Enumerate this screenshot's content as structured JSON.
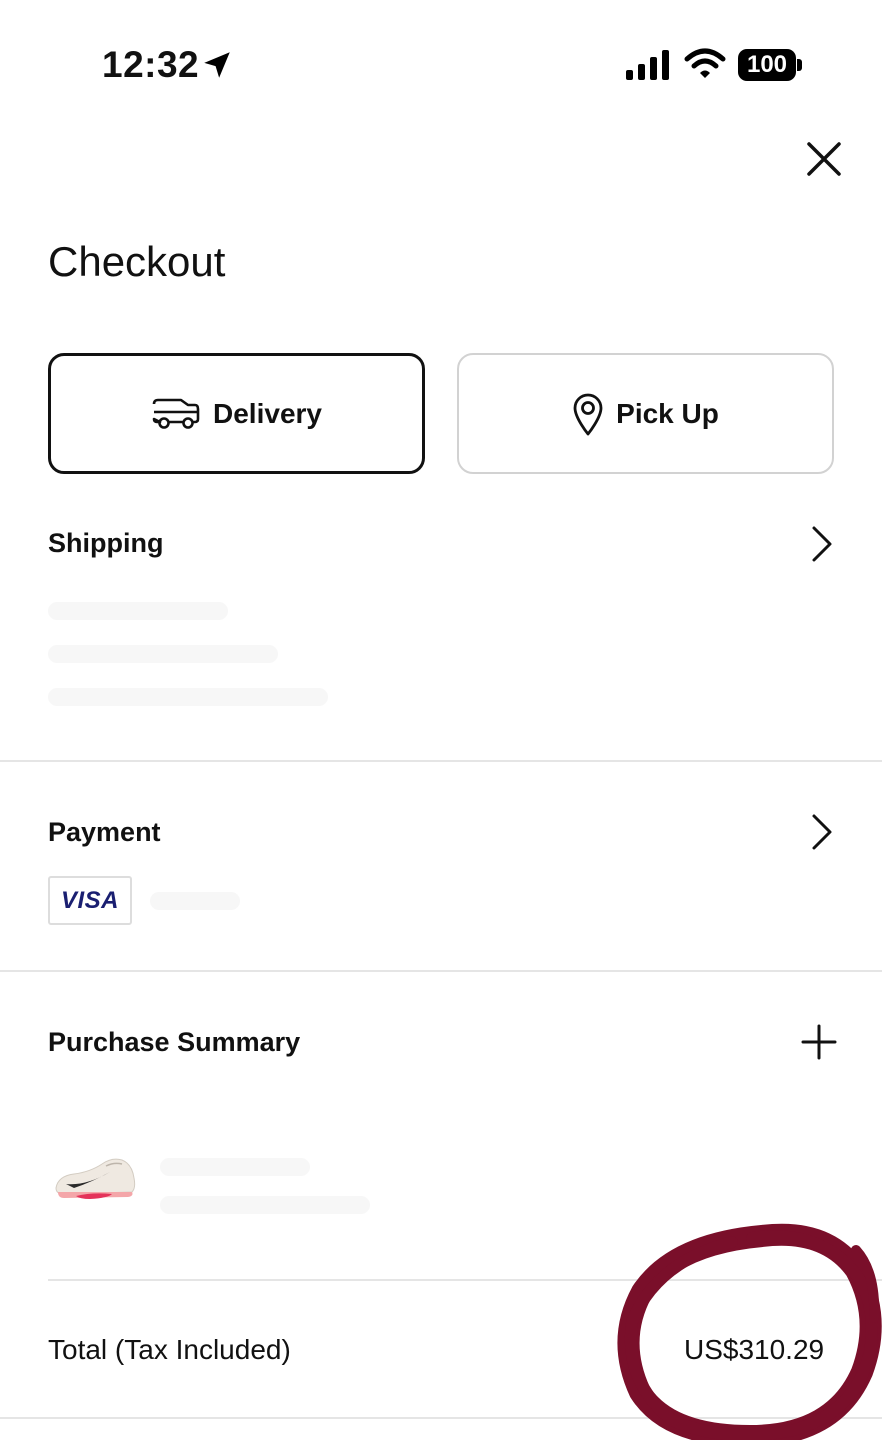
{
  "status_bar": {
    "time": "12:32",
    "battery": "100",
    "icons": [
      "location-arrow-icon",
      "signal-icon",
      "wifi-icon",
      "battery-icon"
    ]
  },
  "header": {
    "close_icon": "close-icon",
    "title": "Checkout"
  },
  "fulfillment": {
    "options": [
      {
        "label": "Delivery",
        "icon": "truck-icon",
        "selected": true
      },
      {
        "label": "Pick Up",
        "icon": "location-pin-icon",
        "selected": false
      }
    ]
  },
  "shipping": {
    "title": "Shipping",
    "icon": "chevron-right-icon"
  },
  "payment": {
    "title": "Payment",
    "icon": "chevron-right-icon",
    "card_brand": "VISA"
  },
  "summary": {
    "title": "Purchase Summary",
    "icon": "plus-icon",
    "item_image": "sneaker-image"
  },
  "total": {
    "label": "Total (Tax Included)",
    "value": "US$310.29"
  },
  "colors": {
    "text": "#111111",
    "divider": "#e5e5e5",
    "unselected_border": "#d2d2d2",
    "visa_blue": "#1a1f71",
    "annotation_marker": "#7a0f2a"
  }
}
